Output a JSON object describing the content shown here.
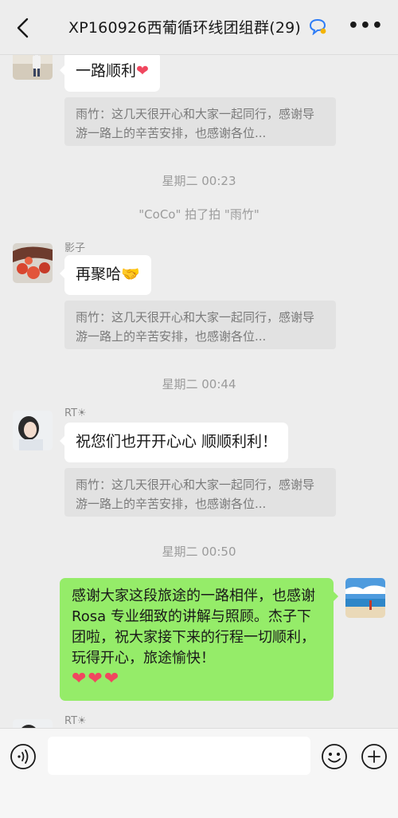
{
  "header": {
    "title": "XP160926西葡循环线团组群(29)"
  },
  "messages": [
    {
      "text": "一路顺利",
      "emoji": "❤"
    },
    {
      "quote": "雨竹：这几天很开心和大家一起同行，感谢导游一路上的辛苦安排，也感谢各位..."
    },
    {
      "time": "星期二 00:23"
    },
    {
      "system": "\"CoCo\" 拍了拍 \"雨竹\""
    },
    {
      "sender": "影子",
      "text": "再聚哈",
      "emoji": "🤝"
    },
    {
      "quote": "雨竹：这几天很开心和大家一起同行，感谢导游一路上的辛苦安排，也感谢各位..."
    },
    {
      "time": "星期二 00:44"
    },
    {
      "sender": "RT☀",
      "text": "祝您们也开开心心 顺顺利利！"
    },
    {
      "quote": "雨竹：这几天很开心和大家一起同行，感谢导游一路上的辛苦安排，也感谢各位..."
    },
    {
      "time": "星期二 00:50"
    },
    {
      "text": "感谢大家这段旅途的一路相伴，也感谢 Rosa 专业细致的讲解与照顾。杰子下团啦，祝大家接下来的行程一切顺利，玩得开心，旅途愉快！",
      "emoji": "❤❤❤"
    },
    {
      "sender": "RT☀"
    }
  ],
  "colors": {
    "background": "#ededed",
    "my_bubble": "#95ec69",
    "other_bubble": "#ffffff",
    "quote_bg": "#e2e2e2"
  },
  "icons": {
    "back": "chevron-left-icon",
    "chat_badge": "chat-bubble-icon",
    "more": "more-icon",
    "voice": "voice-icon",
    "emoji": "emoji-icon",
    "plus": "plus-icon"
  }
}
